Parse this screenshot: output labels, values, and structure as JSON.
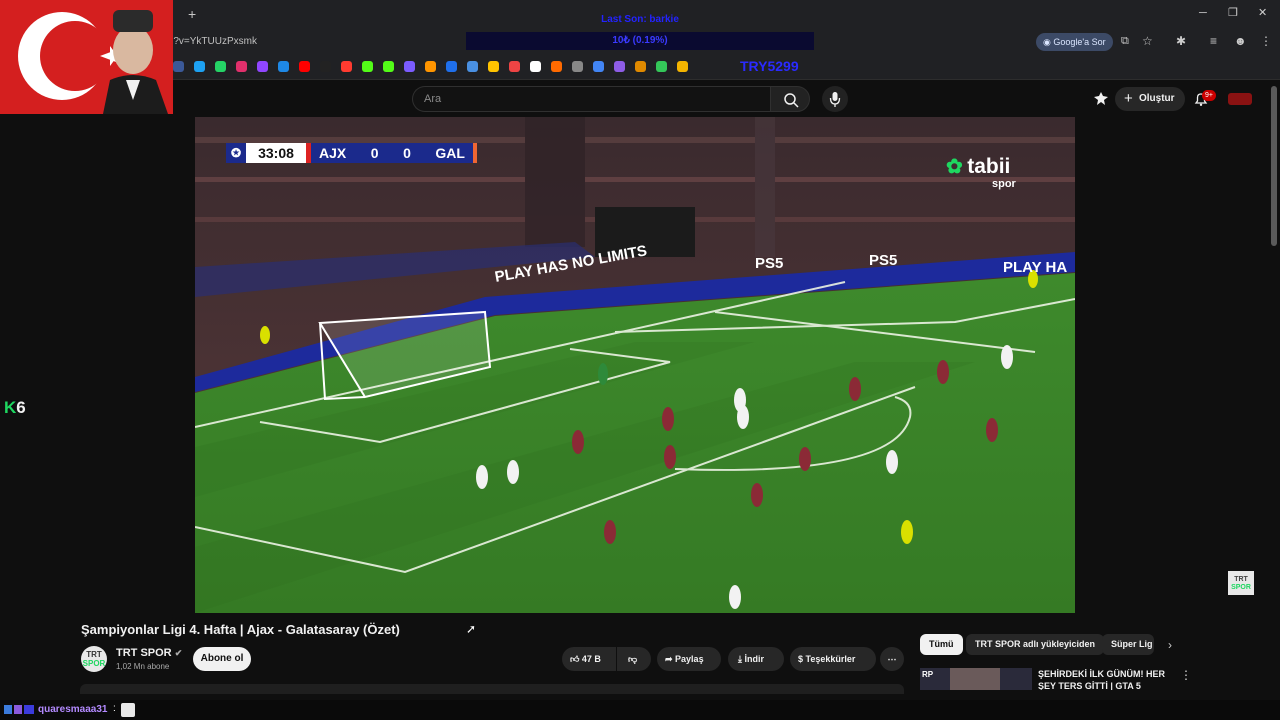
{
  "browser": {
    "url_fragment": "tch?v=YkTUUzPxsmk",
    "ask_google_label": "Google'a Sor",
    "new_tab_symbol": "+",
    "window_controls": [
      "─",
      "❐",
      "✕"
    ]
  },
  "stream_overlay": {
    "top_banner": "Last Son: barkie",
    "goal_bar": "10₺ (0.19%)",
    "goal_prefix": "TRY",
    "goal_number": "TRY5299",
    "k6_label_k": "K",
    "k6_label_num": "6"
  },
  "youtube": {
    "search_placeholder": "Ara",
    "create_label": "Oluştur",
    "notification_count": "9+",
    "video": {
      "title": "Şampiyonlar Ligi 4. Hafta | Ajax - Galatasaray (Özet)",
      "scorebug": {
        "clock": "33:08",
        "home": "AJX",
        "home_score": "0",
        "away_score": "0",
        "away": "GAL"
      },
      "broadcaster_logo_main": "tabii",
      "broadcaster_logo_sub": "spor",
      "ad_board_text": "PLAY HAS NO LIMITS",
      "ad_board_brand": "PS5",
      "ad_board_right": "PLAY HA",
      "watermark_line1": "TRT",
      "watermark_line2": "SPOR"
    },
    "channel": {
      "avatar_line1": "TRT",
      "avatar_line2": "SPOR",
      "name": "TRT SPOR",
      "subscribers": "1,02 Mn abone",
      "subscribe_label": "Abone ol"
    },
    "actions": {
      "like_count": "47 B",
      "share_label": "Paylaş",
      "download_label": "İndir",
      "thanks_label": "Teşekkürler",
      "more_label": "⋯"
    },
    "chips": [
      "Tümü",
      "TRT SPOR adlı yükleyiciden",
      "Süper Lig"
    ],
    "recommendation": {
      "title": "ŞEHİRDEKİ İLK GÜNÜM! HER ŞEY TERS GİTTİ | GTA 5",
      "thumb_badge": "RP"
    }
  },
  "chat": {
    "username": "quaresmaaa31",
    "separator": ":"
  },
  "colors": {
    "youtube_bg": "#0f0f0f",
    "flag_red": "#d41f1f",
    "pitch_green": "#3f8a2a",
    "scorebug_blue": "#1b2a8c",
    "overlay_blue": "#2a2aff",
    "chat_username": "#b38aff"
  }
}
